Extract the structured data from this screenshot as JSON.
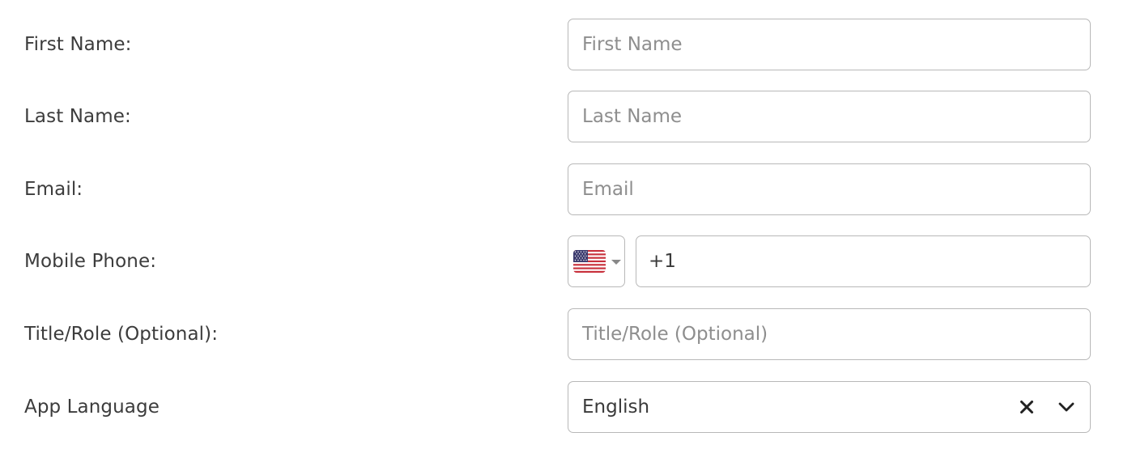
{
  "form": {
    "first_name": {
      "label": "First Name:",
      "placeholder": "First Name",
      "value": ""
    },
    "last_name": {
      "label": "Last Name:",
      "placeholder": "Last Name",
      "value": ""
    },
    "email": {
      "label": "Email:",
      "placeholder": "Email",
      "value": ""
    },
    "mobile_phone": {
      "label": "Mobile Phone:",
      "country_icon": "us-flag-icon",
      "value": "+1"
    },
    "title_role": {
      "label": "Title/Role (Optional):",
      "placeholder": "Title/Role (Optional)",
      "value": ""
    },
    "app_language": {
      "label": "App Language",
      "selected": "English",
      "clear_icon": "close-icon",
      "dropdown_icon": "chevron-down-icon"
    }
  },
  "colors": {
    "border": "#b8b8b8",
    "label_text": "#3c3c3c",
    "placeholder": "#8e8e8e",
    "icon": "#222222"
  }
}
